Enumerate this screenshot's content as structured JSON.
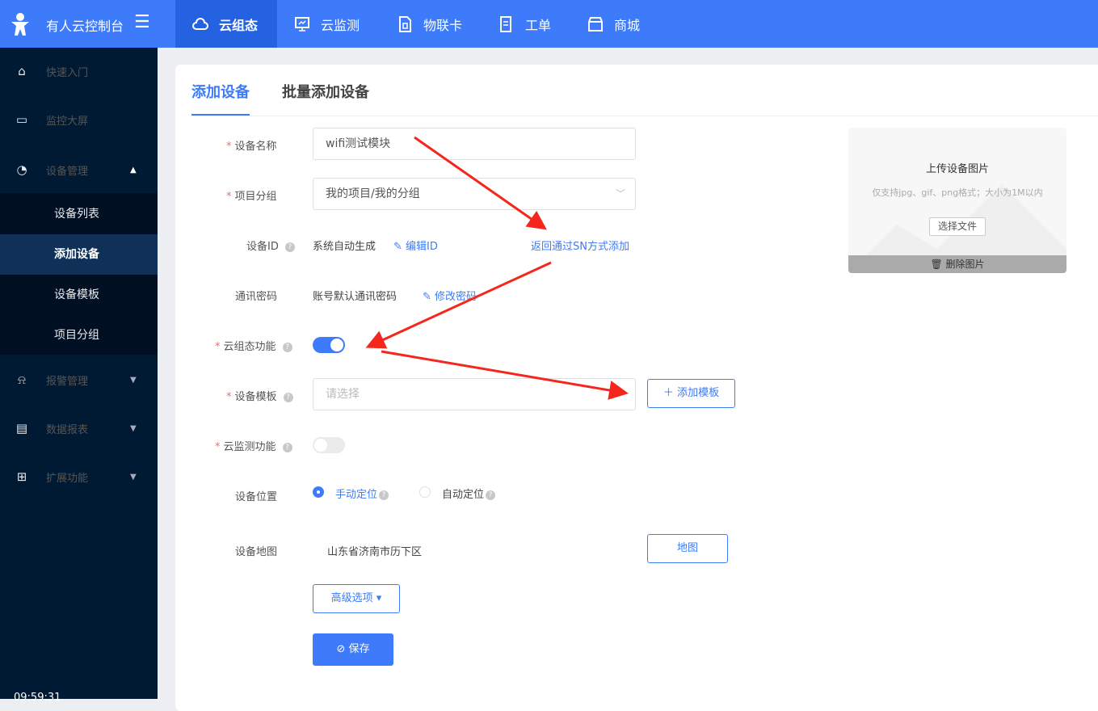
{
  "topbar": {
    "brand": "有人云控制台",
    "nav": [
      {
        "label": "云组态",
        "icon": "cloud-icon",
        "active": true
      },
      {
        "label": "云监测",
        "icon": "monitor-icon"
      },
      {
        "label": "物联卡",
        "icon": "sim-card-icon"
      },
      {
        "label": "工单",
        "icon": "ticket-icon"
      },
      {
        "label": "商城",
        "icon": "shop-icon"
      }
    ]
  },
  "sidebar": {
    "items": [
      {
        "label": "快速入门",
        "icon": "home-icon"
      },
      {
        "label": "监控大屏",
        "icon": "screen-icon"
      },
      {
        "label": "设备管理",
        "icon": "pie-chart-icon",
        "expanded": true
      },
      {
        "label": "报警管理",
        "icon": "alarm-icon"
      },
      {
        "label": "数据报表",
        "icon": "report-icon"
      },
      {
        "label": "扩展功能",
        "icon": "apps-icon"
      }
    ],
    "sub_items": [
      {
        "label": "设备列表"
      },
      {
        "label": "添加设备",
        "active": true
      },
      {
        "label": "设备模板"
      },
      {
        "label": "项目分组"
      }
    ],
    "clock": "09:59:31"
  },
  "tabs": [
    {
      "label": "添加设备",
      "active": true
    },
    {
      "label": "批量添加设备"
    }
  ],
  "form": {
    "name_label": "设备名称",
    "name_value": "wifi测试模块",
    "group_label": "项目分组",
    "group_value": "我的项目/我的分组",
    "id_label": "设备ID",
    "id_value": "系统自动生成",
    "id_edit": "编辑ID",
    "sn_link": "返回通过SN方式添加",
    "pwd_label": "通讯密码",
    "pwd_value": "账号默认通讯密码",
    "pwd_edit": "修改密码",
    "scada_label": "云组态功能",
    "scada_on": true,
    "template_label": "设备模板",
    "template_placeholder": "请选择",
    "add_template": "添加模板",
    "monitor_label": "云监测功能",
    "monitor_on": false,
    "location_label": "设备位置",
    "location_manual": "手动定位",
    "location_auto": "自动定位",
    "location_selected": "手动定位",
    "map_label": "设备地图",
    "map_value": "山东省济南市历下区",
    "map_button": "地图",
    "advanced": "高级选项",
    "save": "保存"
  },
  "upload": {
    "title": "上传设备图片",
    "hint": "仅支持jpg、gif、png格式；大小为1M以内",
    "choose": "选择文件",
    "delete": "删除图片"
  },
  "colors": {
    "primary": "#3e7bfa",
    "sidebar": "#011a33",
    "annotation": "#f5261c"
  }
}
